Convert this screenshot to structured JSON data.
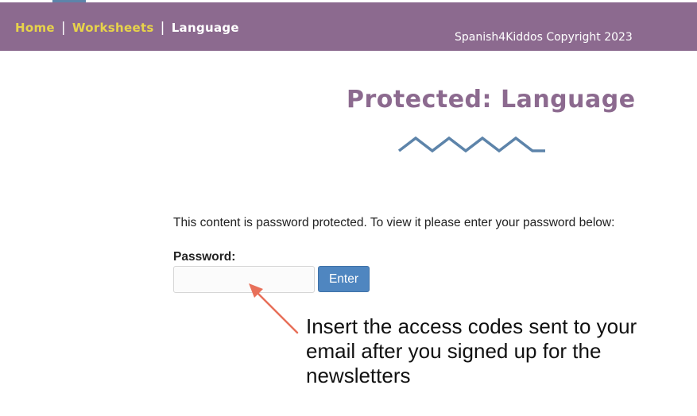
{
  "nav": {
    "home": "Home",
    "worksheets": "Worksheets",
    "language": "Language",
    "separator": "|"
  },
  "footer_note": {
    "copyright": "Spanish4Kiddos Copyright 2023"
  },
  "colors": {
    "navbar_bg": "#8c6a8f",
    "nav_link_yellow": "#e7d34a",
    "title_purple": "#8c6a8f",
    "zigzag_blue": "#5d84aa",
    "button_blue": "#4f86c0",
    "arrow_red": "#e8705a"
  },
  "main": {
    "title": "Protected: Language",
    "intro": "This content is password protected. To view it please enter your password below:",
    "password_label": "Password:",
    "password_value": "",
    "enter_label": "Enter"
  },
  "annotation": {
    "text": "Insert the access codes sent to your email after you signed up for the newsletters"
  }
}
